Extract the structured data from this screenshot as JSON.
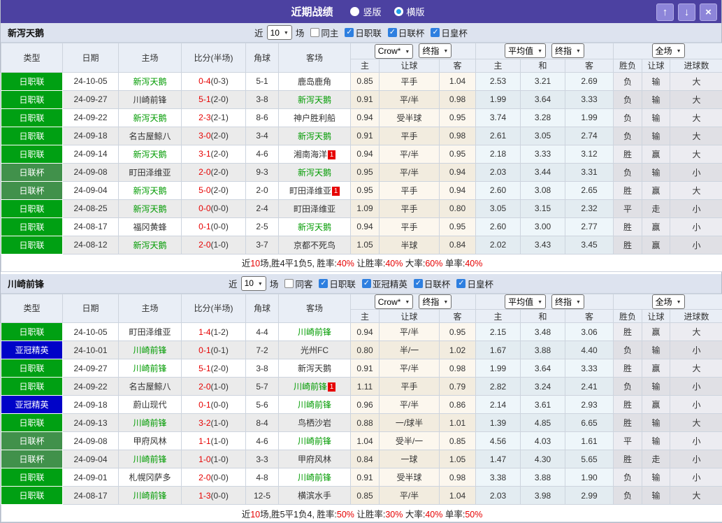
{
  "title_bar": {
    "title": "近期战绩",
    "layout_radios": [
      {
        "label": "竖版",
        "checked": false
      },
      {
        "label": "横版",
        "checked": true
      }
    ]
  },
  "icons": {
    "chevron_down": "▼",
    "check": "✓",
    "up_arrow": "↑",
    "down_arrow": "↓",
    "close": "×"
  },
  "colors": {
    "titlebar_bg": "#4c41a1",
    "titlebar_button_bg": "#8d85d9",
    "section_strip_bg": "#dde3ef",
    "header_bg": "#e9eef6",
    "team_highlight": "#009b00",
    "score_red": "#e60000",
    "checkbox_blue": "#2e7fe0",
    "radio_dot_blue": "#1fa0e8",
    "red_text": "#d42a2a",
    "blue_text": "#2929cf",
    "green_text": "#0da10d",
    "type_colors": {
      "日职联": "#00a013",
      "日联杯": "#41914b",
      "亚冠精英": "#0003c8"
    },
    "result_map": {
      "胜": "red",
      "赢": "red",
      "大": "red",
      "负": "blue",
      "输": "blue",
      "小": "blue",
      "平": "green",
      "走": "green"
    }
  },
  "table_header": {
    "cols": [
      "类型",
      "日期",
      "主场",
      "比分(半场)",
      "角球",
      "客场"
    ],
    "groups": [
      {
        "selects": [
          "Crow*",
          "终指"
        ],
        "cols": [
          "主",
          "让球",
          "客"
        ]
      },
      {
        "selects": [
          "平均值",
          "终指"
        ],
        "cols": [
          "主",
          "和",
          "客"
        ]
      },
      {
        "selects": [
          "全场"
        ],
        "cols": [
          "胜负",
          "让球",
          "进球数"
        ]
      }
    ]
  },
  "sections": [
    {
      "team": "新泻天鹅",
      "filter": {
        "near_label": "近",
        "count": "10",
        "games_label": "场",
        "same_label": "同主",
        "same_checked": false,
        "leagues": [
          {
            "label": "日职联",
            "checked": true
          },
          {
            "label": "日联杯",
            "checked": true
          },
          {
            "label": "日皇杯",
            "checked": true
          }
        ]
      },
      "rows": [
        {
          "type": "日职联",
          "date": "24-10-05",
          "home": "新泻天鹅",
          "hh": 1,
          "score": "0-4",
          "half": "(0-3)",
          "corner": "5-1",
          "away": "鹿岛鹿角",
          "o": [
            "0.85",
            "平手",
            "1.04"
          ],
          "a": [
            "2.53",
            "3.21",
            "2.69"
          ],
          "r": [
            "负",
            "输",
            "大"
          ]
        },
        {
          "type": "日职联",
          "date": "24-09-27",
          "home": "川崎前锋",
          "score": "5-1",
          "half": "(2-0)",
          "corner": "3-8",
          "away": "新泻天鹅",
          "ah": 1,
          "o": [
            "0.91",
            "平/半",
            "0.98"
          ],
          "a": [
            "1.99",
            "3.64",
            "3.33"
          ],
          "r": [
            "负",
            "输",
            "大"
          ]
        },
        {
          "type": "日职联",
          "date": "24-09-22",
          "home": "新泻天鹅",
          "hh": 1,
          "score": "2-3",
          "half": "(2-1)",
          "corner": "8-6",
          "away": "神户胜利船",
          "o": [
            "0.94",
            "受半球",
            "0.95"
          ],
          "a": [
            "3.74",
            "3.28",
            "1.99"
          ],
          "r": [
            "负",
            "输",
            "大"
          ]
        },
        {
          "type": "日职联",
          "date": "24-09-18",
          "home": "名古屋鲸八",
          "score": "3-0",
          "half": "(2-0)",
          "corner": "3-4",
          "away": "新泻天鹅",
          "ah": 1,
          "o": [
            "0.91",
            "平手",
            "0.98"
          ],
          "a": [
            "2.61",
            "3.05",
            "2.74"
          ],
          "r": [
            "负",
            "输",
            "大"
          ]
        },
        {
          "type": "日职联",
          "date": "24-09-14",
          "home": "新泻天鹅",
          "hh": 1,
          "score": "3-1",
          "half": "(2-0)",
          "corner": "4-6",
          "away": "湘南海洋",
          "arc": 1,
          "o": [
            "0.94",
            "平/半",
            "0.95"
          ],
          "a": [
            "2.18",
            "3.33",
            "3.12"
          ],
          "r": [
            "胜",
            "赢",
            "大"
          ]
        },
        {
          "type": "日联杯",
          "date": "24-09-08",
          "home": "町田泽维亚",
          "score": "2-0",
          "half": "(2-0)",
          "corner": "9-3",
          "away": "新泻天鹅",
          "ah": 1,
          "o": [
            "0.95",
            "平/半",
            "0.94"
          ],
          "a": [
            "2.03",
            "3.44",
            "3.31"
          ],
          "r": [
            "负",
            "输",
            "小"
          ]
        },
        {
          "type": "日联杯",
          "date": "24-09-04",
          "home": "新泻天鹅",
          "hh": 1,
          "score": "5-0",
          "half": "(2-0)",
          "corner": "2-0",
          "away": "町田泽维亚",
          "arc": 1,
          "o": [
            "0.95",
            "平手",
            "0.94"
          ],
          "a": [
            "2.60",
            "3.08",
            "2.65"
          ],
          "r": [
            "胜",
            "赢",
            "大"
          ]
        },
        {
          "type": "日职联",
          "date": "24-08-25",
          "home": "新泻天鹅",
          "hh": 1,
          "score": "0-0",
          "half": "(0-0)",
          "corner": "2-4",
          "away": "町田泽维亚",
          "o": [
            "1.09",
            "平手",
            "0.80"
          ],
          "a": [
            "3.05",
            "3.15",
            "2.32"
          ],
          "r": [
            "平",
            "走",
            "小"
          ]
        },
        {
          "type": "日职联",
          "date": "24-08-17",
          "home": "福冈黄蜂",
          "score": "0-1",
          "half": "(0-0)",
          "corner": "2-5",
          "away": "新泻天鹅",
          "ah": 1,
          "o": [
            "0.94",
            "平手",
            "0.95"
          ],
          "a": [
            "2.60",
            "3.00",
            "2.77"
          ],
          "r": [
            "胜",
            "赢",
            "小"
          ]
        },
        {
          "type": "日职联",
          "date": "24-08-12",
          "home": "新泻天鹅",
          "hh": 1,
          "score": "2-0",
          "half": "(1-0)",
          "corner": "3-7",
          "away": "京都不死鸟",
          "o": [
            "1.05",
            "半球",
            "0.84"
          ],
          "a": [
            "2.02",
            "3.43",
            "3.45"
          ],
          "r": [
            "胜",
            "赢",
            "小"
          ]
        }
      ],
      "summary": [
        {
          "t": "近"
        },
        {
          "t": "10",
          "red": true
        },
        {
          "t": "场,胜4平1负5, 胜率:"
        },
        {
          "t": "40%",
          "red": true
        },
        {
          "t": " 让胜率:"
        },
        {
          "t": "40%",
          "red": true
        },
        {
          "t": " 大率:"
        },
        {
          "t": "60%",
          "red": true
        },
        {
          "t": " 单率:"
        },
        {
          "t": "40%",
          "red": true
        }
      ]
    },
    {
      "team": "川崎前锋",
      "filter": {
        "near_label": "近",
        "count": "10",
        "games_label": "场",
        "same_label": "同客",
        "same_checked": false,
        "leagues": [
          {
            "label": "日职联",
            "checked": true
          },
          {
            "label": "亚冠精英",
            "checked": true
          },
          {
            "label": "日联杯",
            "checked": true
          },
          {
            "label": "日皇杯",
            "checked": true
          }
        ]
      },
      "rows": [
        {
          "type": "日职联",
          "date": "24-10-05",
          "home": "町田泽维亚",
          "score": "1-4",
          "half": "(1-2)",
          "corner": "4-4",
          "away": "川崎前锋",
          "ah": 1,
          "o": [
            "0.94",
            "平/半",
            "0.95"
          ],
          "a": [
            "2.15",
            "3.48",
            "3.06"
          ],
          "r": [
            "胜",
            "赢",
            "大"
          ]
        },
        {
          "type": "亚冠精英",
          "date": "24-10-01",
          "home": "川崎前锋",
          "hh": 1,
          "score": "0-1",
          "half": "(0-1)",
          "corner": "7-2",
          "away": "光州FC",
          "o": [
            "0.80",
            "半/一",
            "1.02"
          ],
          "a": [
            "1.67",
            "3.88",
            "4.40"
          ],
          "r": [
            "负",
            "输",
            "小"
          ]
        },
        {
          "type": "日职联",
          "date": "24-09-27",
          "home": "川崎前锋",
          "hh": 1,
          "score": "5-1",
          "half": "(2-0)",
          "corner": "3-8",
          "away": "新泻天鹅",
          "o": [
            "0.91",
            "平/半",
            "0.98"
          ],
          "a": [
            "1.99",
            "3.64",
            "3.33"
          ],
          "r": [
            "胜",
            "赢",
            "大"
          ]
        },
        {
          "type": "日职联",
          "date": "24-09-22",
          "home": "名古屋鲸八",
          "score": "2-0",
          "half": "(1-0)",
          "corner": "5-7",
          "away": "川崎前锋",
          "ah": 1,
          "arc": 1,
          "o": [
            "1.11",
            "平手",
            "0.79"
          ],
          "a": [
            "2.82",
            "3.24",
            "2.41"
          ],
          "r": [
            "负",
            "输",
            "小"
          ]
        },
        {
          "type": "亚冠精英",
          "date": "24-09-18",
          "home": "蔚山现代",
          "score": "0-1",
          "half": "(0-0)",
          "corner": "5-6",
          "away": "川崎前锋",
          "ah": 1,
          "o": [
            "0.96",
            "平/半",
            "0.86"
          ],
          "a": [
            "2.14",
            "3.61",
            "2.93"
          ],
          "r": [
            "胜",
            "赢",
            "小"
          ]
        },
        {
          "type": "日职联",
          "date": "24-09-13",
          "home": "川崎前锋",
          "hh": 1,
          "score": "3-2",
          "half": "(1-0)",
          "corner": "8-4",
          "away": "鸟栖沙岩",
          "o": [
            "0.88",
            "一/球半",
            "1.01"
          ],
          "a": [
            "1.39",
            "4.85",
            "6.65"
          ],
          "r": [
            "胜",
            "输",
            "大"
          ]
        },
        {
          "type": "日联杯",
          "date": "24-09-08",
          "home": "甲府风林",
          "score": "1-1",
          "half": "(1-0)",
          "corner": "4-6",
          "away": "川崎前锋",
          "ah": 1,
          "o": [
            "1.04",
            "受半/一",
            "0.85"
          ],
          "a": [
            "4.56",
            "4.03",
            "1.61"
          ],
          "r": [
            "平",
            "输",
            "小"
          ]
        },
        {
          "type": "日联杯",
          "date": "24-09-04",
          "home": "川崎前锋",
          "hh": 1,
          "score": "1-0",
          "half": "(1-0)",
          "corner": "3-3",
          "away": "甲府风林",
          "o": [
            "0.84",
            "一球",
            "1.05"
          ],
          "a": [
            "1.47",
            "4.30",
            "5.65"
          ],
          "r": [
            "胜",
            "走",
            "小"
          ]
        },
        {
          "type": "日职联",
          "date": "24-09-01",
          "home": "札幌冈萨多",
          "score": "2-0",
          "half": "(0-0)",
          "corner": "4-8",
          "away": "川崎前锋",
          "ah": 1,
          "o": [
            "0.91",
            "受半球",
            "0.98"
          ],
          "a": [
            "3.38",
            "3.88",
            "1.90"
          ],
          "r": [
            "负",
            "输",
            "小"
          ]
        },
        {
          "type": "日职联",
          "date": "24-08-17",
          "home": "川崎前锋",
          "hh": 1,
          "score": "1-3",
          "half": "(0-0)",
          "corner": "12-5",
          "away": "横滨水手",
          "o": [
            "0.85",
            "平/半",
            "1.04"
          ],
          "a": [
            "2.03",
            "3.98",
            "2.99"
          ],
          "r": [
            "负",
            "输",
            "大"
          ]
        }
      ],
      "summary": [
        {
          "t": "近"
        },
        {
          "t": "10",
          "red": true
        },
        {
          "t": "场,胜5平1负4, 胜率:"
        },
        {
          "t": "50%",
          "red": true
        },
        {
          "t": " 让胜率:"
        },
        {
          "t": "30%",
          "red": true
        },
        {
          "t": " 大率:"
        },
        {
          "t": "40%",
          "red": true
        },
        {
          "t": " 单率:"
        },
        {
          "t": "50%",
          "red": true
        }
      ]
    }
  ]
}
